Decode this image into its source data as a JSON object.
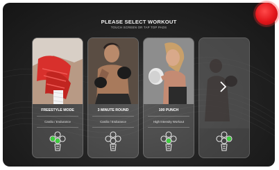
{
  "header": {
    "title": "PLEASE SELECT WORKOUT",
    "subtitle": "TOUCH SCREEN OR TAP TOP PADS"
  },
  "cards": [
    {
      "name": "FREESTYLE MODE",
      "type": "Cardio / Endurance",
      "image": "hands-wrapping-red-boxing-wraps"
    },
    {
      "name": "3 MINUTE ROUND",
      "type": "Cardio / Endurance",
      "image": "man-in-guard-stance"
    },
    {
      "name": "100 PUNCH",
      "type": "High Intensity Workout",
      "image": "woman-boxer-punching"
    },
    {
      "name": "",
      "type": "",
      "image": "boxer-silhouette"
    }
  ],
  "colors": {
    "background": "#1f1f1f",
    "accent_green": "#3ecf3e",
    "record_red": "#e3161b"
  },
  "icons": [
    "punch-bag-icon",
    "chevron-right-icon",
    "record-button-icon"
  ]
}
